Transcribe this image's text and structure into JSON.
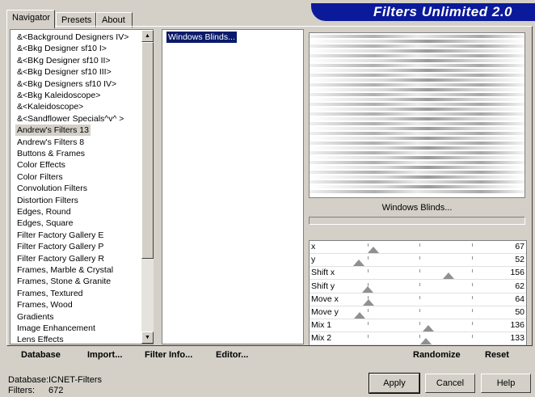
{
  "app": {
    "title": "Filters Unlimited 2.0"
  },
  "tabs": [
    {
      "label": "Navigator"
    },
    {
      "label": "Presets"
    },
    {
      "label": "About"
    }
  ],
  "categories": [
    "&<Background Designers IV>",
    "&<Bkg Designer sf10 I>",
    "&<BKg Designer sf10 II>",
    "&<Bkg Designer sf10 III>",
    "&<Bkg Designers sf10 IV>",
    "&<Bkg Kaleidoscope>",
    "&<Kaleidoscope>",
    "&<Sandflower Specials^v^ >",
    "Andrew's Filters 13",
    "Andrew's Filters 8",
    "Buttons & Frames",
    "Color Effects",
    "Color Filters",
    "Convolution Filters",
    "Distortion Filters",
    "Edges, Round",
    "Edges, Square",
    "Filter Factory Gallery E",
    "Filter Factory Gallery P",
    "Filter Factory Gallery R",
    "Frames, Marble & Crystal",
    "Frames, Stone & Granite",
    "Frames, Textured",
    "Frames, Wood",
    "Gradients",
    "Image Enhancement",
    "Lens Effects"
  ],
  "selected_category": "Andrew's Filters 13",
  "filters": [
    "Windows Blinds..."
  ],
  "preview_label": "Windows Blinds...",
  "params": [
    {
      "name": "x",
      "value": "67"
    },
    {
      "name": "y",
      "value": "52"
    },
    {
      "name": "Shift x",
      "value": "156"
    },
    {
      "name": "Shift y",
      "value": "62"
    },
    {
      "name": "Move x",
      "value": "64"
    },
    {
      "name": "Move y",
      "value": "50"
    },
    {
      "name": "Mix 1",
      "value": "136"
    },
    {
      "name": "Mix 2",
      "value": "133"
    }
  ],
  "actions": {
    "database": "Database",
    "import": "Import...",
    "filter_info": "Filter Info...",
    "editor": "Editor...",
    "randomize": "Randomize",
    "reset": "Reset"
  },
  "status": {
    "database_label": "Database:",
    "database_value": "ICNET-Filters",
    "filters_label": "Filters:",
    "filters_value": "672"
  },
  "buttons": {
    "apply": "Apply",
    "cancel": "Cancel",
    "help": "Help"
  },
  "icons": {
    "scroll_up": "triangle-up-icon",
    "scroll_down": "triangle-down-icon"
  }
}
